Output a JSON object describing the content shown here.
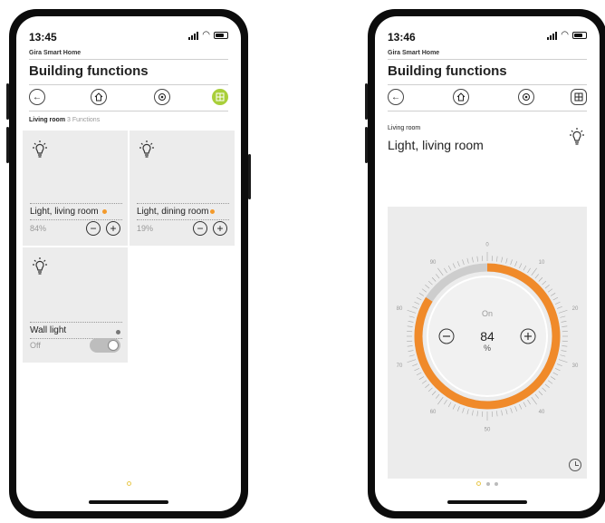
{
  "left_phone": {
    "status": {
      "time": "13:45"
    },
    "app_name": "Gira Smart Home",
    "title": "Building functions",
    "breadcrumb": {
      "room": "Living room",
      "count": "3 Functions"
    },
    "tiles": [
      {
        "name": "Light, living room",
        "value": "84%",
        "status_color": "#f39a2b",
        "control": "dimmer",
        "icon": "light-bulb-icon"
      },
      {
        "name": "Light, dining room",
        "value": "19%",
        "status_color": "#f39a2b",
        "control": "dimmer",
        "icon": "light-bulb-icon"
      },
      {
        "name": "Wall light",
        "value": "Off",
        "status_color": "#777777",
        "control": "switch",
        "icon": "light-bulb-icon"
      }
    ],
    "page_dots": 1
  },
  "right_phone": {
    "status": {
      "time": "13:46"
    },
    "app_name": "Gira Smart Home",
    "title": "Building functions",
    "room": "Living room",
    "function_title": "Light, living room",
    "dial": {
      "state": "On",
      "value": "84",
      "unit": "%",
      "level_percent": 84,
      "tick_labels": [
        "0",
        "10",
        "20",
        "30",
        "40",
        "50",
        "60",
        "70",
        "80",
        "90"
      ]
    },
    "page_dots": 3
  },
  "colors": {
    "accent_orange": "#f39a2b",
    "accent_green": "#a9cf3a",
    "tile_bg": "#ececec"
  },
  "toolbar_icons": [
    "back-arrow-icon",
    "home-icon",
    "favorites-icon",
    "grid-icon"
  ]
}
